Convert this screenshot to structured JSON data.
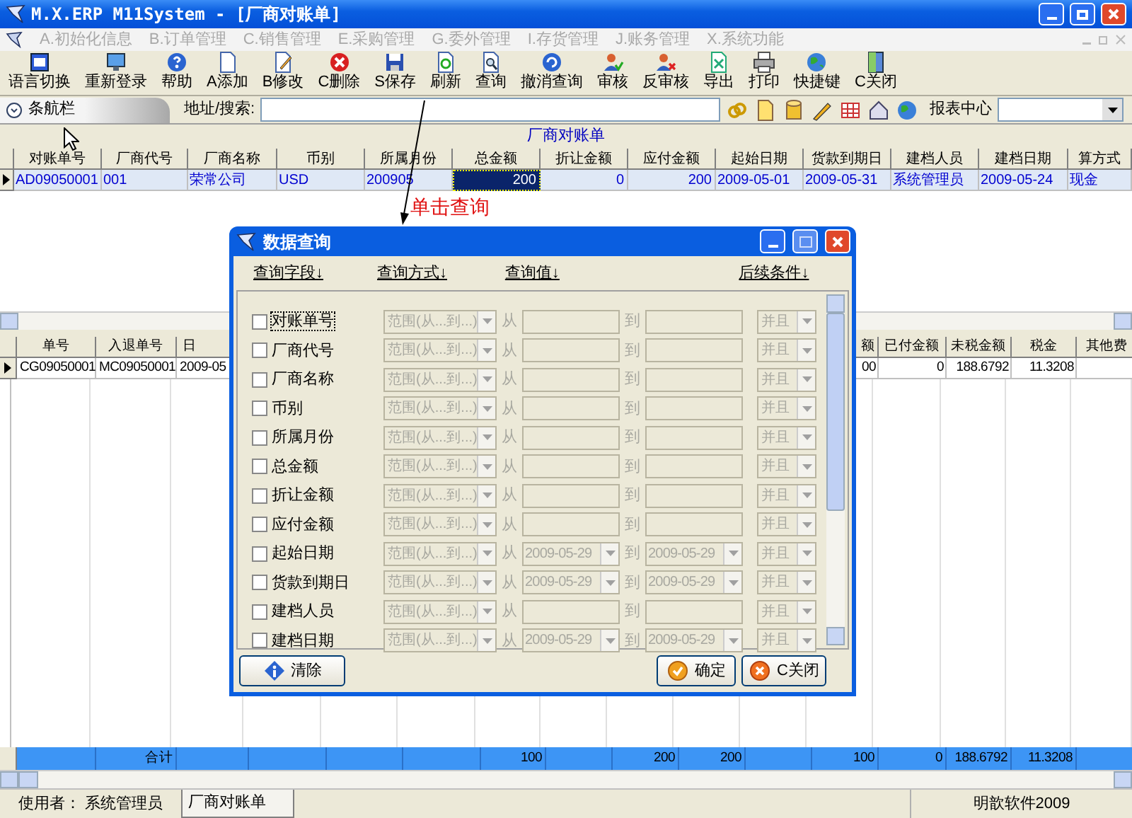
{
  "window": {
    "title": "M.X.ERP M11System - [厂商对账单]"
  },
  "menu": [
    {
      "label": "A.初始化信息",
      "disabled": true
    },
    {
      "label": "B.订单管理",
      "disabled": true
    },
    {
      "label": "C.销售管理",
      "disabled": true
    },
    {
      "label": "E.采购管理",
      "disabled": true
    },
    {
      "label": "G.委外管理",
      "disabled": true
    },
    {
      "label": "I.存货管理",
      "disabled": true
    },
    {
      "label": "J.账务管理",
      "disabled": true
    },
    {
      "label": "X.系统功能",
      "disabled": true
    }
  ],
  "toolbar": [
    "语言切换",
    "重新登录",
    "帮助",
    "A添加",
    "B修改",
    "C删除",
    "S保存",
    "刷新",
    "查询",
    "撤消查询",
    "审核",
    "反审核",
    "导出",
    "打印",
    "快捷键",
    "C关闭"
  ],
  "nav": {
    "tab": "条航栏",
    "address_label": "地址/搜索:",
    "report_label": "报表中心"
  },
  "master": {
    "caption": "厂商对账单",
    "columns": [
      {
        "label": "对账单号",
        "kind": "text"
      },
      {
        "label": "厂商代号",
        "kind": "text"
      },
      {
        "label": "厂商名称",
        "kind": "text"
      },
      {
        "label": "币别",
        "kind": "text"
      },
      {
        "label": "所属月份",
        "kind": "text"
      },
      {
        "label": "总金额",
        "kind": "number"
      },
      {
        "label": "折让金额",
        "kind": "number"
      },
      {
        "label": "应付金额",
        "kind": "number"
      },
      {
        "label": "起始日期",
        "kind": "text"
      },
      {
        "label": "货款到期日",
        "kind": "text"
      },
      {
        "label": "建档人员",
        "kind": "text"
      },
      {
        "label": "建档日期",
        "kind": "text"
      },
      {
        "label": "算方式",
        "kind": "text"
      }
    ],
    "rows": [
      {
        "selected": true,
        "cells": [
          {
            "text": "AD09050001",
            "selected": false
          },
          {
            "text": "001",
            "selected": false
          },
          {
            "text": "荣常公司",
            "selected": false
          },
          {
            "text": "USD",
            "selected": false
          },
          {
            "text": "200905",
            "selected": false
          },
          {
            "text": "200",
            "selected": true
          },
          {
            "text": "0",
            "selected": false
          },
          {
            "text": "200",
            "selected": false
          },
          {
            "text": "2009-05-01",
            "selected": false
          },
          {
            "text": "2009-05-31",
            "selected": false
          },
          {
            "text": "系统管理员",
            "selected": false
          },
          {
            "text": "2009-05-24",
            "selected": false
          },
          {
            "text": "现金",
            "selected": false
          }
        ]
      }
    ]
  },
  "detail": {
    "row_selected": true,
    "columns": [
      {
        "label": "单号",
        "kind": "text",
        "value": "CG09050001"
      },
      {
        "label": "入退单号",
        "kind": "text",
        "value": "MC09050001",
        "total": "合计"
      },
      {
        "label": "日",
        "kind": "text",
        "value": "2009-05"
      },
      {
        "kind": "number"
      },
      {
        "kind": "number"
      },
      {
        "kind": "number"
      },
      {
        "kind": "number",
        "total": "100"
      },
      {
        "kind": "number"
      },
      {
        "kind": "number",
        "total": "200"
      },
      {
        "kind": "number",
        "total": "200"
      },
      {
        "kind": "number"
      },
      {
        "label": "额",
        "kind": "number",
        "value": "00",
        "total": "100"
      },
      {
        "label": "已付金额",
        "kind": "number",
        "value": "0",
        "total": "0"
      },
      {
        "label": "未税金额",
        "kind": "number",
        "value": "188.6792",
        "total": "188.6792"
      },
      {
        "label": "税金",
        "kind": "number",
        "value": "11.3208",
        "total": "11.3208"
      },
      {
        "label": "其他费",
        "kind": "number"
      }
    ]
  },
  "annotation": {
    "text": "单击查询"
  },
  "dialog": {
    "title": "数据查询",
    "headers": [
      "查询字段↓",
      "查询方式↓",
      "查询值↓",
      "后续条件↓"
    ],
    "rows": [
      {
        "field": "对账单号",
        "kind": "text",
        "checked": false,
        "focused": true,
        "disabled": true,
        "method": "范围(从...到...)",
        "from_label": "从",
        "to_label": "到",
        "condition": "并且"
      },
      {
        "field": "厂商代号",
        "kind": "text",
        "checked": false,
        "focused": false,
        "disabled": true,
        "method": "范围(从...到...)",
        "from_label": "从",
        "to_label": "到",
        "condition": "并且"
      },
      {
        "field": "厂商名称",
        "kind": "text",
        "checked": false,
        "focused": false,
        "disabled": true,
        "method": "范围(从...到...)",
        "from_label": "从",
        "to_label": "到",
        "condition": "并且"
      },
      {
        "field": "币别",
        "kind": "text",
        "checked": false,
        "focused": false,
        "disabled": true,
        "method": "范围(从...到...)",
        "from_label": "从",
        "to_label": "到",
        "condition": "并且"
      },
      {
        "field": "所属月份",
        "kind": "text",
        "checked": false,
        "focused": false,
        "disabled": true,
        "method": "范围(从...到...)",
        "from_label": "从",
        "to_label": "到",
        "condition": "并且"
      },
      {
        "field": "总金额",
        "kind": "text",
        "checked": false,
        "focused": false,
        "disabled": true,
        "method": "范围(从...到...)",
        "from_label": "从",
        "to_label": "到",
        "condition": "并且"
      },
      {
        "field": "折让金额",
        "kind": "text",
        "checked": false,
        "focused": false,
        "disabled": true,
        "method": "范围(从...到...)",
        "from_label": "从",
        "to_label": "到",
        "condition": "并且"
      },
      {
        "field": "应付金额",
        "kind": "text",
        "checked": false,
        "focused": false,
        "disabled": true,
        "method": "范围(从...到...)",
        "from_label": "从",
        "to_label": "到",
        "condition": "并且"
      },
      {
        "field": "起始日期",
        "kind": "date",
        "checked": false,
        "focused": false,
        "disabled": true,
        "method": "范围(从...到...)",
        "from_label": "从",
        "from": "2009-05-29",
        "to_label": "到",
        "to": "2009-05-29",
        "condition": "并且"
      },
      {
        "field": "货款到期日",
        "kind": "date",
        "checked": false,
        "focused": false,
        "disabled": true,
        "method": "范围(从...到...)",
        "from_label": "从",
        "from": "2009-05-29",
        "to_label": "到",
        "to": "2009-05-29",
        "condition": "并且"
      },
      {
        "field": "建档人员",
        "kind": "text",
        "checked": false,
        "focused": false,
        "disabled": true,
        "method": "范围(从...到...)",
        "from_label": "从",
        "to_label": "到",
        "condition": "并且"
      },
      {
        "field": "建档日期",
        "kind": "date",
        "checked": false,
        "focused": false,
        "disabled": true,
        "method": "范围(从...到...)",
        "from_label": "从",
        "from": "2009-05-29",
        "to_label": "到",
        "to": "2009-05-29",
        "condition": "并且"
      }
    ],
    "buttons": [
      {
        "label": "清除",
        "kind": "clear"
      },
      {
        "label": "确定",
        "kind": "ok"
      },
      {
        "label": "C关闭",
        "kind": "close"
      }
    ]
  },
  "status_bar": {
    "user": "使用者： 系统管理员",
    "tabs": [
      {
        "label": "厂商对账单",
        "selected": true
      }
    ],
    "company": "明歆软件2009"
  }
}
